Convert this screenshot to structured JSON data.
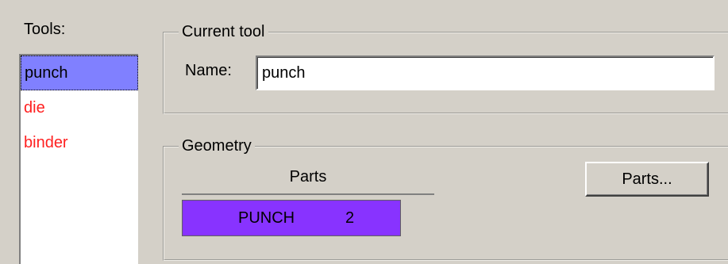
{
  "tools": {
    "label": "Tools:",
    "items": [
      {
        "label": "punch",
        "selected": true,
        "color": "#000000"
      },
      {
        "label": "die",
        "selected": false,
        "color": "#ff2020"
      },
      {
        "label": "binder",
        "selected": false,
        "color": "#ff2020"
      }
    ]
  },
  "current_tool": {
    "title": "Current tool",
    "name_label": "Name:",
    "name_value": "punch"
  },
  "geometry": {
    "title": "Geometry",
    "parts_header": "Parts",
    "parts_rows": [
      {
        "name": "PUNCH",
        "count": "2"
      }
    ],
    "parts_button_label": "Parts..."
  },
  "colors": {
    "selected_bg": "#8080ff",
    "part_row_bg": "#8833ff",
    "unselected_tool": "#ff2020",
    "dialog_bg": "#d4d0c8"
  }
}
